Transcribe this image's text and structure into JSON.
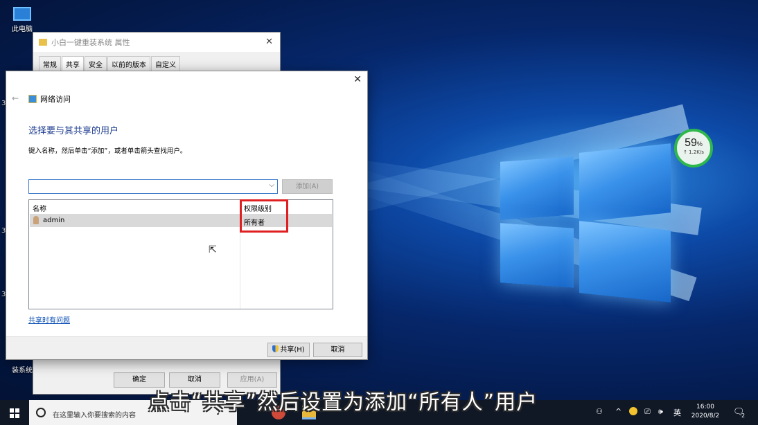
{
  "desktop": {
    "icons": [
      {
        "label": "此电脑"
      },
      {
        "label": "装系统"
      }
    ],
    "edge_labels": [
      "3",
      "3",
      "3"
    ]
  },
  "speed_widget": {
    "percent": "59",
    "unit": "%",
    "rate": "↑ 1.2K/s",
    "ring_color": "#2eb84c"
  },
  "properties_window": {
    "title": "小白一键重装系统 属性",
    "close_glyph": "✕",
    "tabs": [
      {
        "label": "常规"
      },
      {
        "label": "共享"
      },
      {
        "label": "安全"
      },
      {
        "label": "以前的版本"
      },
      {
        "label": "自定义"
      }
    ],
    "active_tab": "共享",
    "buttons": {
      "ok": "确定",
      "cancel": "取消",
      "apply": "应用(A)"
    }
  },
  "dialog": {
    "title": "网络访问",
    "close_glyph": "✕",
    "back_glyph": "←",
    "heading": "选择要与其共享的用户",
    "instruction": "键入名称，然后单击“添加”，或者单击箭头查找用户。",
    "input": {
      "value": "",
      "placeholder": ""
    },
    "add_button": "添加(A)",
    "columns": {
      "name": "名称",
      "permission": "权限级别"
    },
    "rows": [
      {
        "name": "admin",
        "permission": "所有者"
      }
    ],
    "help_link": "共享时有问题",
    "share_button": "共享(H)",
    "cancel_button": "取消",
    "highlight_color": "#e02020"
  },
  "subtitle": "点击“共享”然后设置为添加“所有人”用户",
  "taskbar": {
    "search_placeholder": "在这里输入你要搜索的内容",
    "tray": {
      "ime": "英",
      "volume": "🕪",
      "notification_count": "2"
    },
    "time": "16:00",
    "date": "2020/8/2"
  }
}
